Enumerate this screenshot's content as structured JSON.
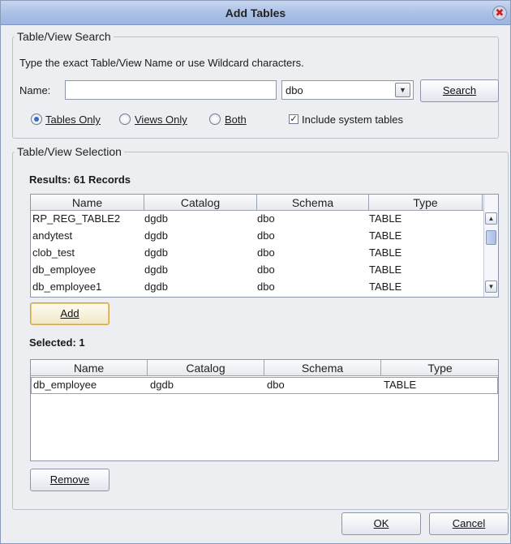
{
  "window": {
    "title": "Add Tables",
    "close_glyph": "✖"
  },
  "search_group": {
    "legend": "Table/View Search",
    "instructions": "Type the exact Table/View Name or use Wildcard characters.",
    "name_label": "Name:",
    "name_value": "",
    "schema_value": "dbo",
    "search_button": "Search",
    "radios": [
      {
        "label": "Tables Only",
        "checked": true
      },
      {
        "label": "Views Only",
        "checked": false
      },
      {
        "label": "Both",
        "checked": false
      }
    ],
    "include_system_tables": {
      "label": "Include system tables",
      "checked": true
    }
  },
  "selection_group": {
    "legend": "Table/View Selection",
    "results_label": "Results: 61 Records",
    "columns": [
      "Name",
      "Catalog",
      "Schema",
      "Type"
    ],
    "results": [
      [
        "RP_REG_TABLE2",
        "dgdb",
        "dbo",
        "TABLE"
      ],
      [
        "andytest",
        "dgdb",
        "dbo",
        "TABLE"
      ],
      [
        "clob_test",
        "dgdb",
        "dbo",
        "TABLE"
      ],
      [
        "db_employee",
        "dgdb",
        "dbo",
        "TABLE"
      ],
      [
        "db_employee1",
        "dgdb",
        "dbo",
        "TABLE"
      ]
    ],
    "add_button": "Add",
    "selected_label": "Selected: 1",
    "selected": [
      [
        "db_employee",
        "dgdb",
        "dbo",
        "TABLE"
      ]
    ],
    "remove_button": "Remove"
  },
  "footer": {
    "ok_button": "OK",
    "cancel_button": "Cancel"
  },
  "colors": {
    "titlebar": "#a9bfe6",
    "accent": "#3a6bc8",
    "focus_border": "#c9a64a"
  }
}
